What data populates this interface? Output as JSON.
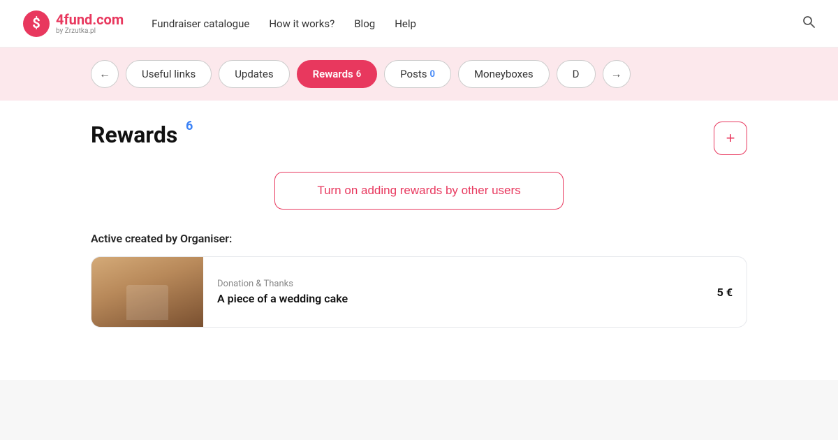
{
  "site": {
    "logo_main": "4fund",
    "logo_domain": ".com",
    "logo_sub": "by Zrzutka.pl"
  },
  "navbar": {
    "links": [
      {
        "label": "Fundraiser catalogue",
        "name": "nav-fundraiser"
      },
      {
        "label": "How it works?",
        "name": "nav-how-it-works"
      },
      {
        "label": "Blog",
        "name": "nav-blog"
      },
      {
        "label": "Help",
        "name": "nav-help"
      }
    ],
    "search_icon": "🔍"
  },
  "tabs": {
    "prev_icon": "←",
    "next_icon": "→",
    "items": [
      {
        "label": "Useful links",
        "badge": "",
        "active": false
      },
      {
        "label": "Updates",
        "badge": "",
        "active": false
      },
      {
        "label": "Rewards",
        "badge": "6",
        "active": true
      },
      {
        "label": "Posts",
        "badge": "0",
        "active": false
      },
      {
        "label": "Moneyboxes",
        "badge": "",
        "active": false
      },
      {
        "label": "D",
        "badge": "",
        "active": false
      }
    ]
  },
  "rewards": {
    "heading": "Rewards",
    "count": "6",
    "add_icon": "+",
    "turn_on_label": "Turn on adding rewards by other users",
    "active_section_label": "Active created by Organiser:",
    "reward_card": {
      "category": "Donation & Thanks",
      "title": "A piece of a wedding cake",
      "price": "5 €"
    }
  }
}
